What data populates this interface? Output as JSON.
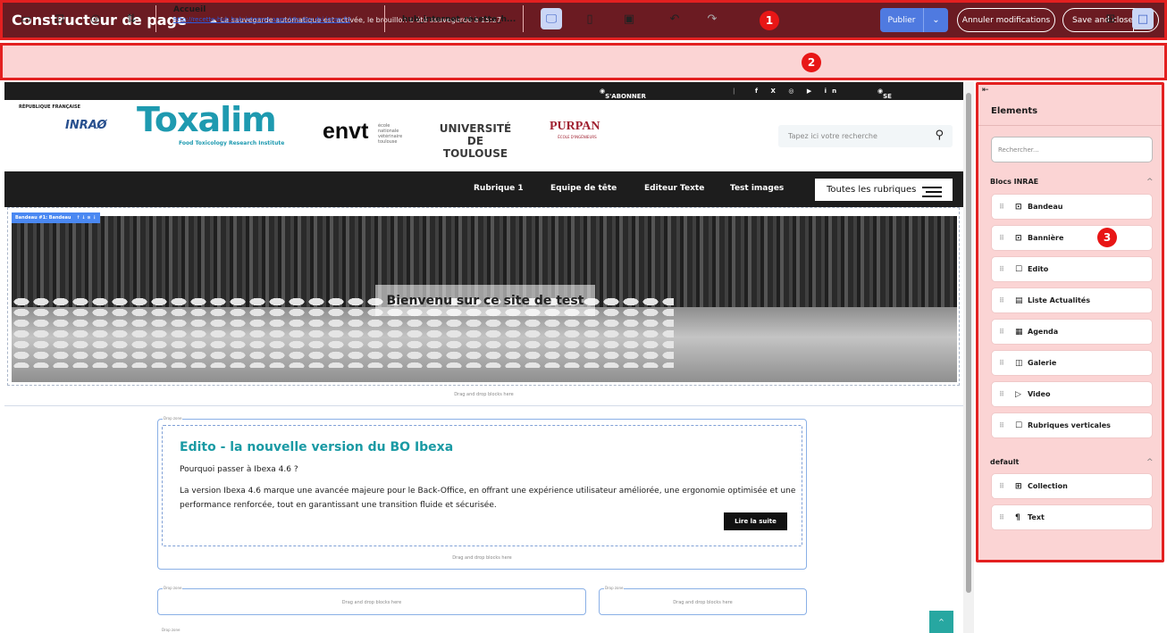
{
  "header": {
    "title": "Constructeur de page",
    "autosave": "La sauvegarde automatique est activée, le brouillon a été sauvegardé à 15:27",
    "publish": "Publier",
    "cancel": "Annuler modifications",
    "save_close": "Save and close"
  },
  "badges": [
    "1",
    "2",
    "3"
  ],
  "toolbar": {
    "page_title": "Accueil",
    "page_url": "http://recette-hub.hub-internet.apps.k8s.dev.dsi.inrae.fr/",
    "site": "hub_internet_recette_h..."
  },
  "site": {
    "subscribe": "S'ABONNER AUX ACTUALITÉS",
    "login": "SE CONNECTER",
    "marianne": "RÉPUBLIQUE FRANÇAISE",
    "inrae": "INRAØ",
    "toxalim": "Toxalim",
    "toxalim_sub": "Food Toxicology Research Institute",
    "envt": "envt",
    "envt_sub": "école nationale vétérinaire toulouse",
    "universite": "UNIVERSITÉ DE TOULOUSE",
    "purpan": "PURPAN",
    "purpan_sub": "ÉCOLE D'INGÉNIEURS",
    "search_placeholder": "Tapez ici votre recherche",
    "nav": [
      "Rubrique 1",
      "Equipe de tête",
      "Editeur Texte",
      "Test images"
    ],
    "all_sections": "Toutes les rubriques",
    "block_label": "Bandeau #1: Bandeau",
    "hero_title": "Bienvenu sur ce site de test",
    "dnd": "Drag and drop blocks here",
    "drop_zone": "Drop zone",
    "edito_title": "Edito - la nouvelle version du BO Ibexa",
    "edito_sub": "Pourquoi passer à Ibexa 4.6 ?",
    "edito_text": "La version Ibexa 4.6 marque une avancée majeure pour le Back-Office, en offrant une expérience utilisateur améliorée, une ergonomie optimisée et une performance renforcée, tout en garantissant une transition fluide et sécurisée.",
    "read_more": "Lire la suite"
  },
  "panel": {
    "title": "Elements",
    "search_placeholder": "Rechercher...",
    "group1": "Blocs INRAE",
    "items1": [
      "Bandeau",
      "Bannière",
      "Edito",
      "Liste Actualités",
      "Agenda",
      "Galerie",
      "Video",
      "Rubriques verticales"
    ],
    "group2": "default",
    "items2": [
      "Collection",
      "Text"
    ]
  }
}
